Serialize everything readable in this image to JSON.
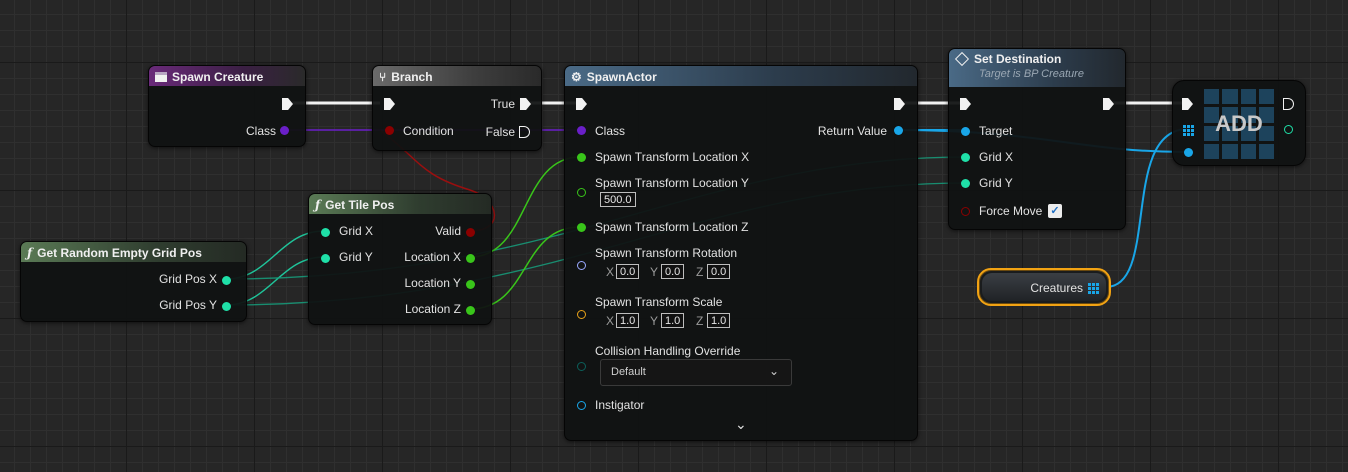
{
  "colors": {
    "exec": "#f2f2f2",
    "class_pin": "#6a1fc8",
    "bool_pin": "#8b0000",
    "int_pin": "#1fe0a8",
    "float_pin": "#39c51a",
    "object_pin": "#19a6e8",
    "rotator_pin": "#9aa8ff",
    "struct_pin": "#e8a21a",
    "enum_pin": "#0b5f5a",
    "variable_outline": "#f2a313"
  },
  "spawn_creature": {
    "title": "Spawn Creature",
    "icon": "variable-box-icon",
    "class_label": "Class"
  },
  "branch": {
    "title": "Branch",
    "icon": "branch-icon",
    "condition_label": "Condition",
    "true_label": "True",
    "false_label": "False"
  },
  "get_tile_pos": {
    "title": "Get Tile Pos",
    "icon": "function-icon",
    "grid_x": "Grid X",
    "grid_y": "Grid Y",
    "valid": "Valid",
    "location_x": "Location X",
    "location_y": "Location Y",
    "location_z": "Location Z"
  },
  "get_random": {
    "title": "Get Random Empty Grid Pos",
    "icon": "function-icon",
    "grid_pos_x": "Grid Pos X",
    "grid_pos_y": "Grid Pos Y"
  },
  "spawn_actor": {
    "title": "SpawnActor",
    "icon": "spawn-icon",
    "class_label": "Class",
    "return_value": "Return Value",
    "loc_x": "Spawn Transform Location X",
    "loc_y": "Spawn Transform Location Y",
    "loc_y_value": "500.0",
    "loc_z": "Spawn Transform Location Z",
    "rotation": "Spawn Transform Rotation",
    "rotation_x": "0.0",
    "rotation_y": "0.0",
    "rotation_z": "0.0",
    "scale": "Spawn Transform Scale",
    "scale_x": "1.0",
    "scale_y": "1.0",
    "scale_z": "1.0",
    "axis_x": "X",
    "axis_y": "Y",
    "axis_z": "Z",
    "collision": "Collision Handling Override",
    "collision_value": "Default",
    "instigator": "Instigator"
  },
  "set_destination": {
    "title": "Set Destination",
    "subtitle": "Target is BP Creature",
    "icon": "event-diamond-icon",
    "target": "Target",
    "grid_x": "Grid X",
    "grid_y": "Grid Y",
    "force_move": "Force Move",
    "force_move_checked": true
  },
  "add_node": {
    "label": "ADD"
  },
  "creatures_var": {
    "label": "Creatures",
    "icon": "array-grid-icon"
  }
}
